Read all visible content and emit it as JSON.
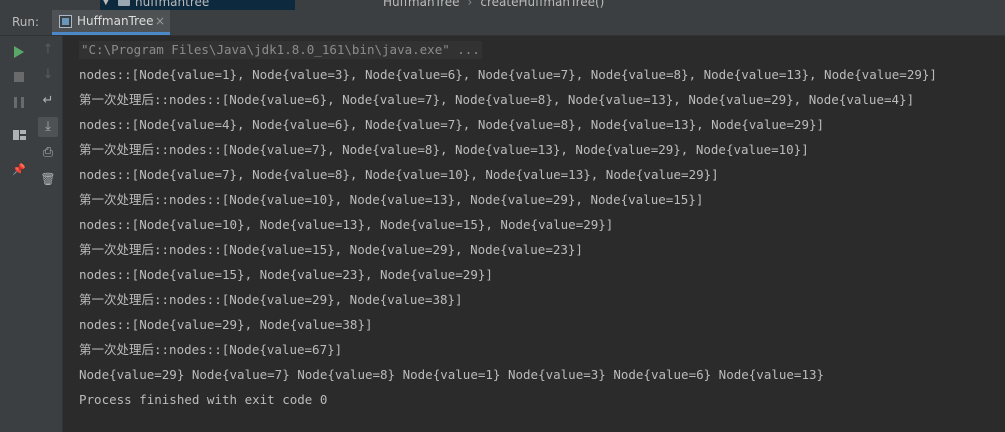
{
  "breadcrumb": {
    "project": "huffmantree",
    "path_1": "HuffmanTree",
    "path_2": "createHuffmanTree()"
  },
  "run_panel": {
    "label": "Run:",
    "tab_label": "HuffmanTree",
    "tab_close": "×"
  },
  "toolbar": {
    "icons": [
      "run-icon",
      "up-arrow-icon",
      "stop-icon",
      "down-arrow-icon",
      "pause-icon",
      "soft-wrap-icon",
      "layout-icon",
      "scroll-to-end-icon",
      "print-icon",
      "pin-icon",
      "trash-icon"
    ],
    "glyphs": {
      "up": "↑",
      "down": "↓",
      "wrap": "↵",
      "scroll": "⤓",
      "print": "⎙",
      "pin": "📌",
      "trash": "🗑"
    }
  },
  "colors": {
    "background": "#2b2b2b",
    "panel": "#3c3f41",
    "run_green": "#59a869",
    "accent_blue": "#4a88c7",
    "console_text": "#bbbbbb"
  },
  "console": {
    "command": "\"C:\\Program Files\\Java\\jdk1.8.0_161\\bin\\java.exe\" ...",
    "lines": [
      "nodes::[Node{value=1}, Node{value=3}, Node{value=6}, Node{value=7}, Node{value=8}, Node{value=13}, Node{value=29}]",
      "第一次处理后::nodes::[Node{value=6}, Node{value=7}, Node{value=8}, Node{value=13}, Node{value=29}, Node{value=4}]",
      "nodes::[Node{value=4}, Node{value=6}, Node{value=7}, Node{value=8}, Node{value=13}, Node{value=29}]",
      "第一次处理后::nodes::[Node{value=7}, Node{value=8}, Node{value=13}, Node{value=29}, Node{value=10}]",
      "nodes::[Node{value=7}, Node{value=8}, Node{value=10}, Node{value=13}, Node{value=29}]",
      "第一次处理后::nodes::[Node{value=10}, Node{value=13}, Node{value=29}, Node{value=15}]",
      "nodes::[Node{value=10}, Node{value=13}, Node{value=15}, Node{value=29}]",
      "第一次处理后::nodes::[Node{value=15}, Node{value=29}, Node{value=23}]",
      "nodes::[Node{value=15}, Node{value=23}, Node{value=29}]",
      "第一次处理后::nodes::[Node{value=29}, Node{value=38}]",
      "nodes::[Node{value=29}, Node{value=38}]",
      "第一次处理后::nodes::[Node{value=67}]",
      "Node{value=29} Node{value=7} Node{value=8} Node{value=1} Node{value=3} Node{value=6} Node{value=13}"
    ],
    "exit_message": "Process finished with exit code 0"
  }
}
